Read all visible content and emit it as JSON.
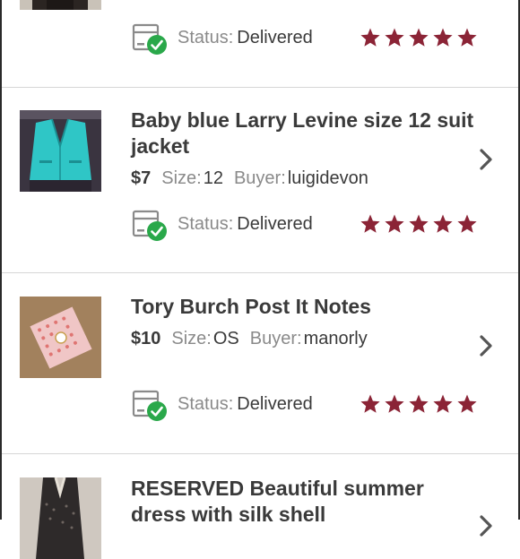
{
  "labels": {
    "status": "Status:",
    "size": "Size:",
    "buyer": "Buyer:"
  },
  "colors": {
    "star": "#8b2436",
    "check_badge": "#2aa84a",
    "chevron": "#555555"
  },
  "icons": {
    "status": "delivered-package-icon",
    "rating": "star-icon",
    "nav": "chevron-right-icon"
  },
  "items": [
    {
      "title": "",
      "price": "",
      "size": "",
      "buyer": "",
      "status": "Delivered",
      "rating": 5
    },
    {
      "title": "Baby blue Larry Levine size 12 suit jacket",
      "price": "$7",
      "size": "12",
      "buyer": "luigidevon",
      "status": "Delivered",
      "rating": 5
    },
    {
      "title": "Tory Burch Post It Notes",
      "price": "$10",
      "size": "OS",
      "buyer": "manorly",
      "status": "Delivered",
      "rating": 5
    },
    {
      "title": "RESERVED Beautiful summer dress with silk shell",
      "price": "",
      "size": "",
      "buyer": "",
      "status": "",
      "rating": 0
    }
  ]
}
